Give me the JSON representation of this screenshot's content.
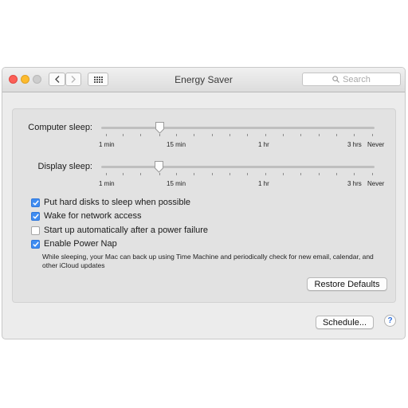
{
  "window": {
    "title": "Energy Saver"
  },
  "search": {
    "placeholder": "Search"
  },
  "sliders": [
    {
      "label": "Computer sleep:",
      "value_label": "15 min",
      "tick_labels": [
        "1 min",
        "15 min",
        "1 hr",
        "3 hrs",
        "Never"
      ]
    },
    {
      "label": "Display sleep:",
      "value_label": "15 min",
      "tick_labels": [
        "1 min",
        "15 min",
        "1 hr",
        "3 hrs",
        "Never"
      ]
    }
  ],
  "options": [
    {
      "label": "Put hard disks to sleep when possible",
      "checked": true
    },
    {
      "label": "Wake for network access",
      "checked": true
    },
    {
      "label": "Start up automatically after a power failure",
      "checked": false
    },
    {
      "label": "Enable Power Nap",
      "checked": true
    }
  ],
  "power_nap_description": "While sleeping, your Mac can back up using Time Machine and periodically check for new email, calendar, and other iCloud updates",
  "buttons": {
    "restore_defaults": "Restore Defaults",
    "schedule": "Schedule...",
    "help": "?"
  },
  "colors": {
    "accent": "#3f8cf1",
    "close": "#fc5f57",
    "minimize": "#fdbb2e"
  }
}
